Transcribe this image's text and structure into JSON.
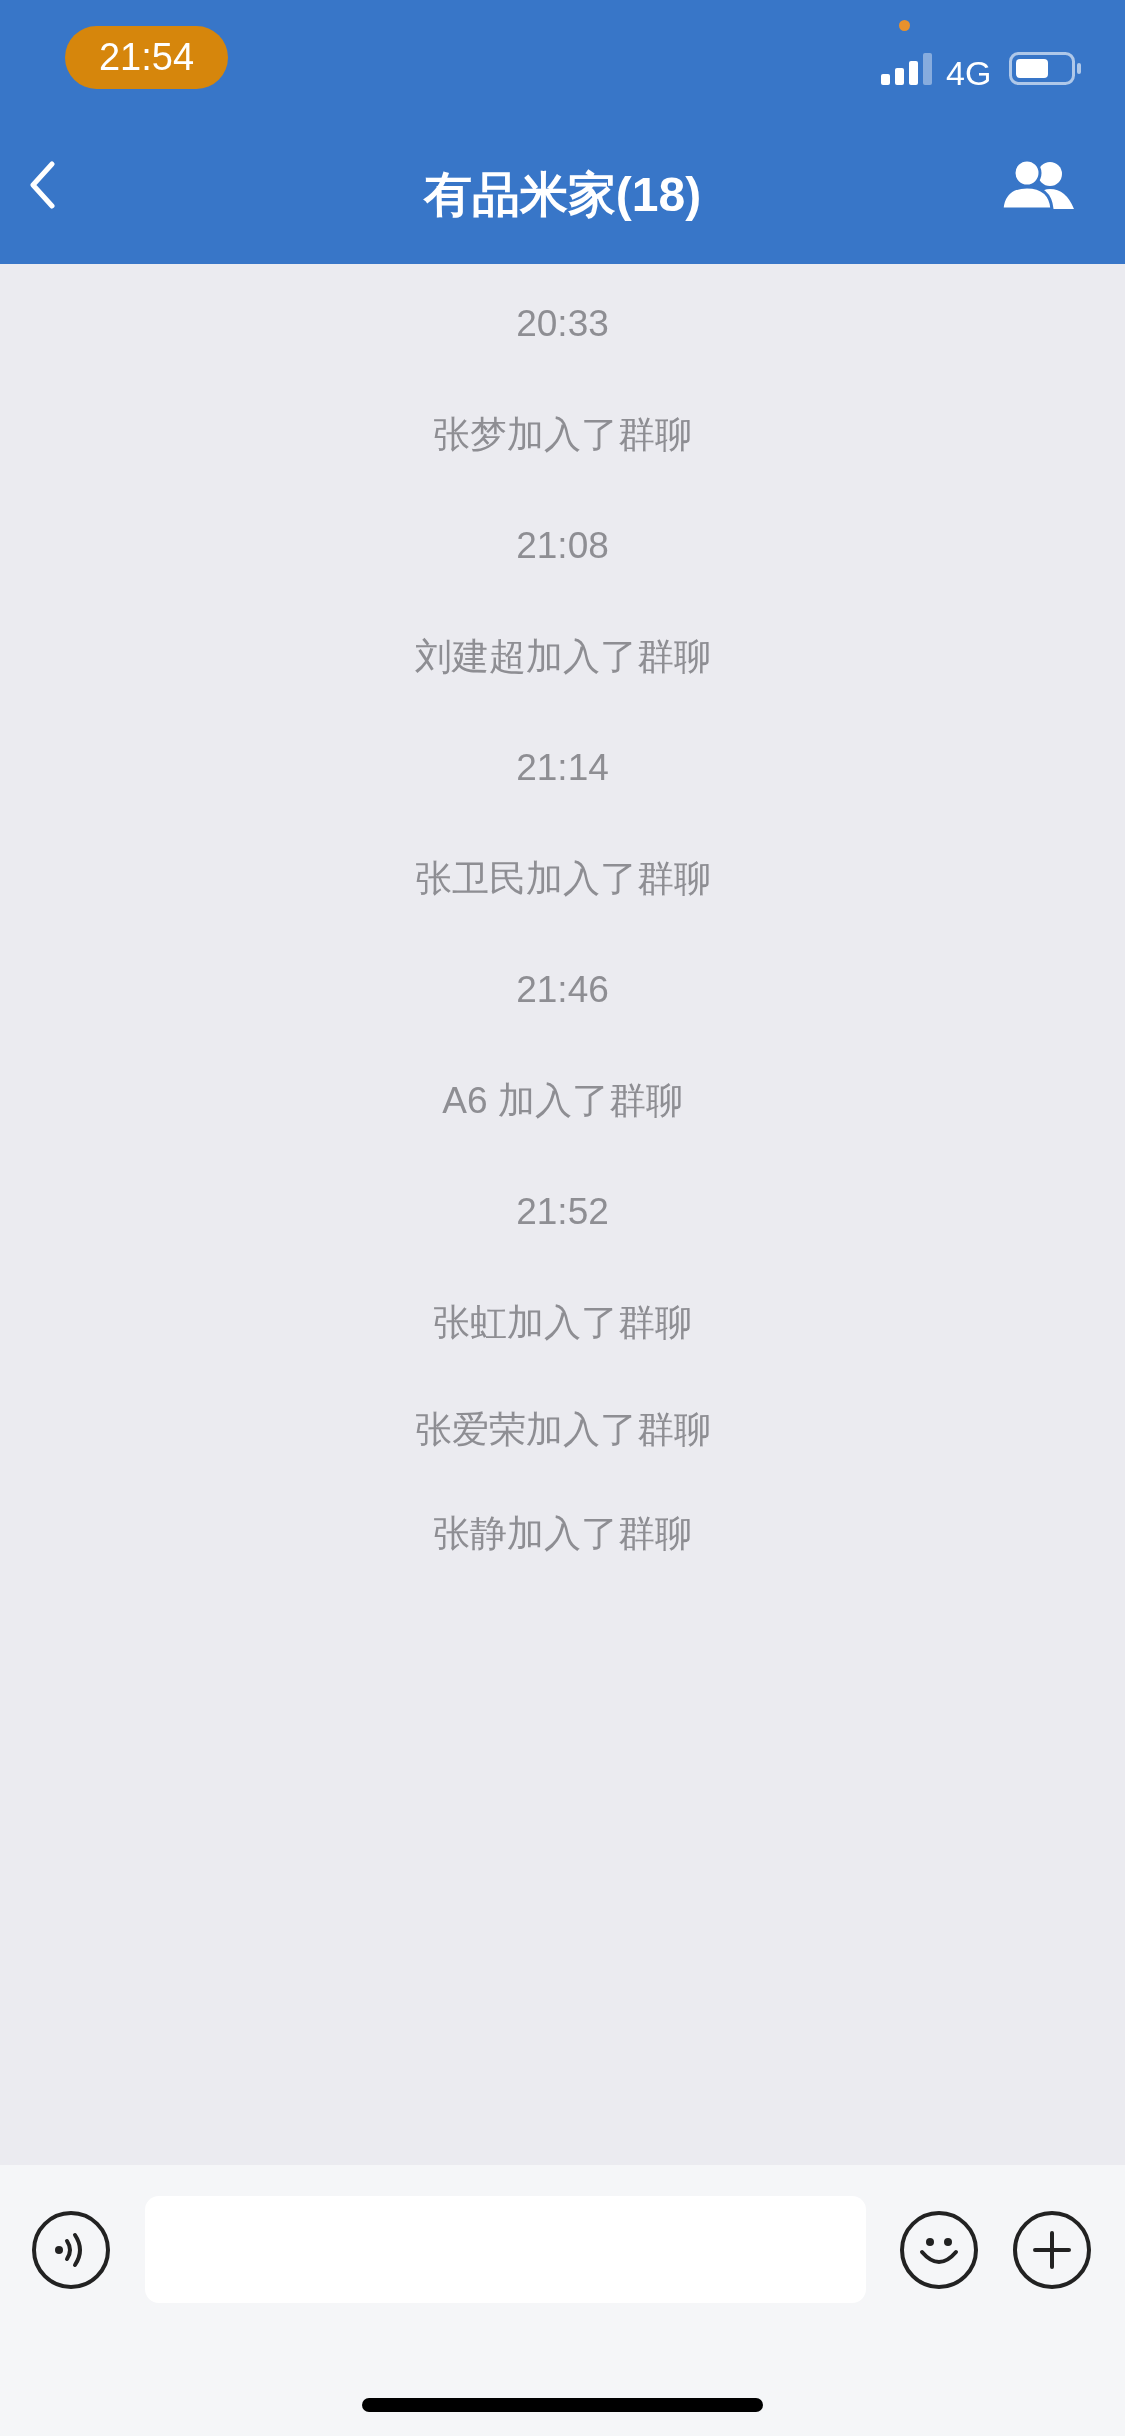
{
  "status_bar": {
    "time": "21:54",
    "network": "4G"
  },
  "nav": {
    "title": "有品米家(18)"
  },
  "messages": [
    {
      "kind": "time",
      "text": "20:33"
    },
    {
      "kind": "system",
      "text": "张梦加入了群聊"
    },
    {
      "kind": "time",
      "text": "21:08"
    },
    {
      "kind": "system",
      "text": "刘建超加入了群聊"
    },
    {
      "kind": "time",
      "text": "21:14"
    },
    {
      "kind": "system",
      "text": "张卫民加入了群聊"
    },
    {
      "kind": "time",
      "text": "21:46"
    },
    {
      "kind": "system",
      "text": "A6 加入了群聊"
    },
    {
      "kind": "time",
      "text": "21:52"
    },
    {
      "kind": "system",
      "text": "张虹加入了群聊"
    },
    {
      "kind": "system",
      "text": "张爱荣加入了群聊"
    },
    {
      "kind": "system",
      "text": "张静加入了群聊"
    }
  ]
}
